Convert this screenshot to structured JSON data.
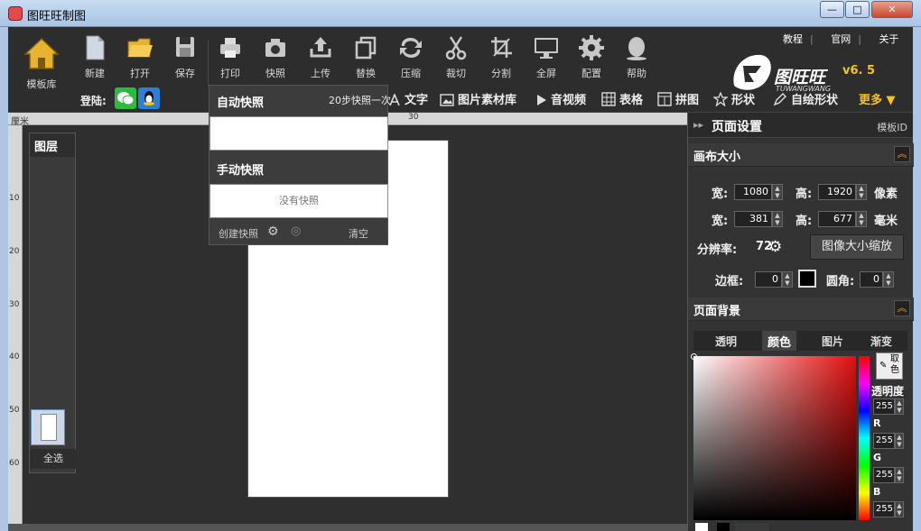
{
  "window": {
    "title": "图旺旺制图",
    "minimize": "—",
    "maximize": "□",
    "close": "✕"
  },
  "toolbar": {
    "template_label": "模板库",
    "tools": [
      {
        "id": "new",
        "label": "新建"
      },
      {
        "id": "open",
        "label": "打开"
      },
      {
        "id": "save",
        "label": "保存"
      },
      {
        "id": "print",
        "label": "打印"
      },
      {
        "id": "snapshot",
        "label": "快照"
      },
      {
        "id": "upload",
        "label": "上传"
      },
      {
        "id": "replace",
        "label": "替换"
      },
      {
        "id": "compress",
        "label": "压缩"
      },
      {
        "id": "crop",
        "label": "裁切"
      },
      {
        "id": "split",
        "label": "分割"
      },
      {
        "id": "fullscreen",
        "label": "全屏"
      },
      {
        "id": "config",
        "label": "配置"
      },
      {
        "id": "help",
        "label": "帮助"
      }
    ],
    "login_label": "登陆:",
    "links": [
      "教程",
      "官网",
      "关于"
    ],
    "brand_name": "图旺旺",
    "brand_sub": "TUWANGWANG",
    "version": "v6. 5"
  },
  "section_bar": {
    "steps_note": "20步快照一次",
    "items": [
      "文字",
      "图片素材库",
      "音视频",
      "表格",
      "拼图",
      "形状",
      "自绘形状"
    ],
    "more": "更多"
  },
  "ruler": {
    "unit": "厘米",
    "top_marks": [
      "30"
    ],
    "left_marks": [
      "10",
      "20",
      "30",
      "40",
      "50",
      "60"
    ]
  },
  "layers": {
    "title": "图层",
    "select_all": "全选"
  },
  "snapshots": {
    "auto_title": "自动快照",
    "manual_title": "手动快照",
    "empty_text": "没有快照",
    "create": "创建快照",
    "clear": "清空"
  },
  "page_settings": {
    "title": "页面设置",
    "template_id": "模板ID",
    "canvas_section": "画布大小",
    "width_label": "宽:",
    "height_label": "高:",
    "width_px": "1080",
    "height_px": "1920",
    "px_unit": "像素",
    "width_mm": "381",
    "height_mm": "677",
    "mm_unit": "毫米",
    "resolution_label": "分辨率:",
    "resolution": "72",
    "resize_button": "图像大小缩放",
    "border_label": "边框:",
    "border_value": "0",
    "radius_label": "圆角:",
    "radius_value": "0",
    "bg_section": "页面背景",
    "bg_tabs": [
      "透明",
      "颜色",
      "图片",
      "渐变"
    ],
    "picker_label": "取色",
    "opacity_label": "透明度",
    "opacity": "255",
    "r_label": "R",
    "r": "255",
    "g_label": "G",
    "g": "255",
    "b_label": "B",
    "b": "255"
  },
  "colors": {
    "accent": "#f5c518",
    "panel": "#333333",
    "canvas": "#2f2f2f",
    "titlebar": "#bcd3ee"
  }
}
